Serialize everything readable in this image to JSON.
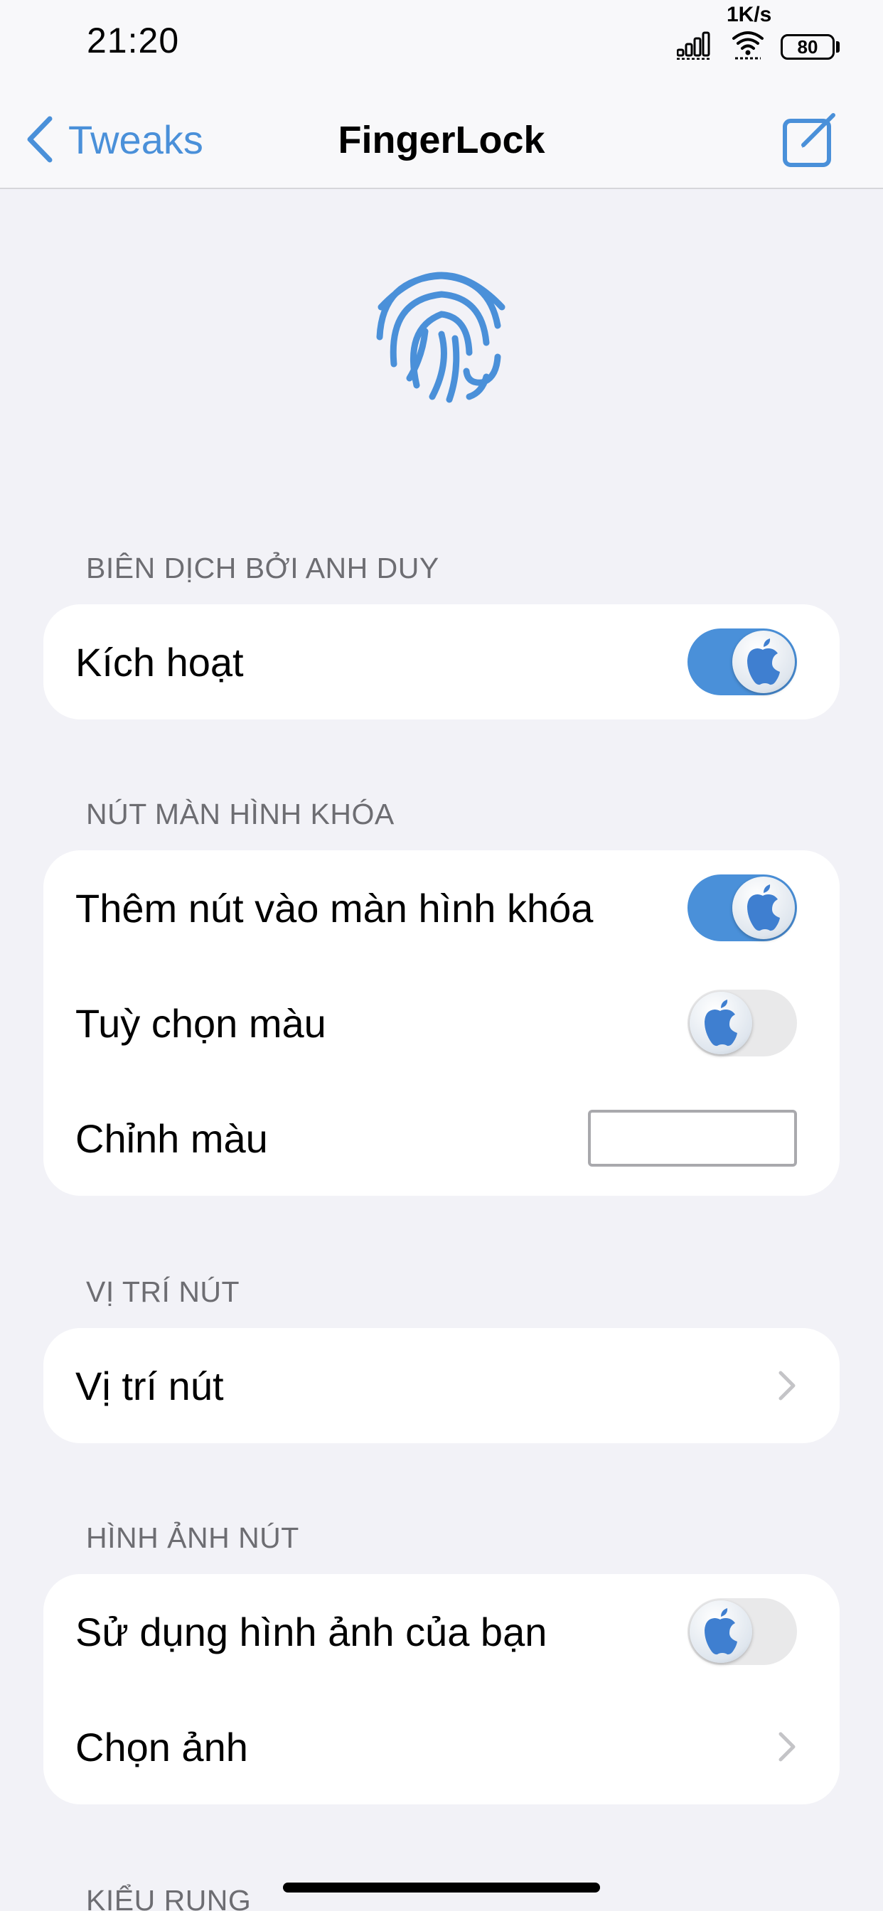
{
  "status_bar": {
    "time": "21:20",
    "net_speed": "1K/s",
    "battery": "80",
    "icons": [
      "cellular-signal-icon",
      "wifi-icon",
      "battery-icon"
    ]
  },
  "nav": {
    "back_label": "Tweaks",
    "title": "FingerLock",
    "icons": [
      "chevron-left-icon",
      "compose-icon"
    ]
  },
  "header": {
    "icon": "fingerprint-icon"
  },
  "colors": {
    "accent": "#4a90d9",
    "background": "#f2f2f7",
    "section_label": "#6d6d72",
    "toggle_off": "#e9e9ea"
  },
  "sections": {
    "s1": {
      "header": "BIÊN DỊCH BỞI ANH DUY",
      "rows": [
        {
          "label": "Kích hoạt",
          "control": "toggle",
          "on": true
        }
      ]
    },
    "s2": {
      "header": "NÚT MÀN HÌNH KHÓA",
      "rows": [
        {
          "label": "Thêm nút vào màn hình khóa",
          "control": "toggle",
          "on": true
        },
        {
          "label": "Tuỳ chọn màu",
          "control": "toggle",
          "on": false
        },
        {
          "label": "Chỉnh màu",
          "control": "color-well",
          "value": "#ffffff"
        }
      ]
    },
    "s3": {
      "header": "VỊ TRÍ NÚT",
      "rows": [
        {
          "label": "Vị trí nút",
          "control": "disclosure"
        }
      ]
    },
    "s4": {
      "header": "HÌNH ẢNH NÚT",
      "rows": [
        {
          "label": "Sử dụng hình ảnh của bạn",
          "control": "toggle",
          "on": false
        },
        {
          "label": "Chọn ảnh",
          "control": "disclosure"
        }
      ]
    },
    "s5": {
      "header": "KIỂU RUNG"
    }
  }
}
